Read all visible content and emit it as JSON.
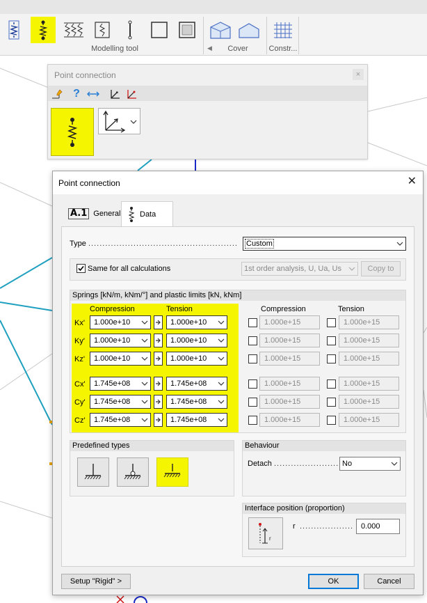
{
  "ribbon": {
    "groups": {
      "modelling": "Modelling tool",
      "cover": "Cover",
      "construction": "Constr..."
    }
  },
  "panel": {
    "title": "Point connection",
    "close": "×"
  },
  "dialog": {
    "title": "Point connection",
    "close": "✕",
    "tabs": [
      {
        "label": "General",
        "prefix": "A.1"
      },
      {
        "label": "Data"
      }
    ],
    "type": {
      "label": "Type",
      "dots": "......................................................",
      "value": "Custom"
    },
    "same_all": {
      "label": "Same for all calculations",
      "checked": true,
      "analysis": "1st order analysis, U, Ua, Us",
      "copy_to": "Copy to"
    },
    "springs": {
      "header": "Springs [kN/m, kNm/°] and plastic limits [kN, kNm]",
      "col_compression": "Compression",
      "col_tension": "Tension",
      "rows": [
        {
          "label": "Kx'",
          "compression": "1.000e+10",
          "tension": "1.000e+10",
          "limit_compression": "1.000e+15",
          "limit_tension": "1.000e+15"
        },
        {
          "label": "Ky'",
          "compression": "1.000e+10",
          "tension": "1.000e+10",
          "limit_compression": "1.000e+15",
          "limit_tension": "1.000e+15"
        },
        {
          "label": "Kz'",
          "compression": "1.000e+10",
          "tension": "1.000e+10",
          "limit_compression": "1.000e+15",
          "limit_tension": "1.000e+15"
        },
        {
          "label": "Cx'",
          "compression": "1.745e+08",
          "tension": "1.745e+08",
          "limit_compression": "1.000e+15",
          "limit_tension": "1.000e+15"
        },
        {
          "label": "Cy'",
          "compression": "1.745e+08",
          "tension": "1.745e+08",
          "limit_compression": "1.000e+15",
          "limit_tension": "1.000e+15"
        },
        {
          "label": "Cz'",
          "compression": "1.745e+08",
          "tension": "1.745e+08",
          "limit_compression": "1.000e+15",
          "limit_tension": "1.000e+15"
        }
      ]
    },
    "predefined": {
      "header": "Predefined types",
      "items": [
        "hinged-support",
        "roller-support",
        "fixed-support"
      ],
      "selected": 2
    },
    "behaviour": {
      "header": "Behaviour",
      "detach_label": "Detach",
      "detach_dots": "...........................",
      "detach_value": "No"
    },
    "interface": {
      "header": "Interface position (proportion)",
      "r_label": "r",
      "r_dots": "....................",
      "r_value": "0.000"
    },
    "buttons": {
      "setup": "Setup \"Rigid\" >",
      "ok": "OK",
      "cancel": "Cancel"
    }
  },
  "colors": {
    "highlight": "#f5f500",
    "model_line": "#1fa0c0",
    "accent": "#0078d7"
  }
}
